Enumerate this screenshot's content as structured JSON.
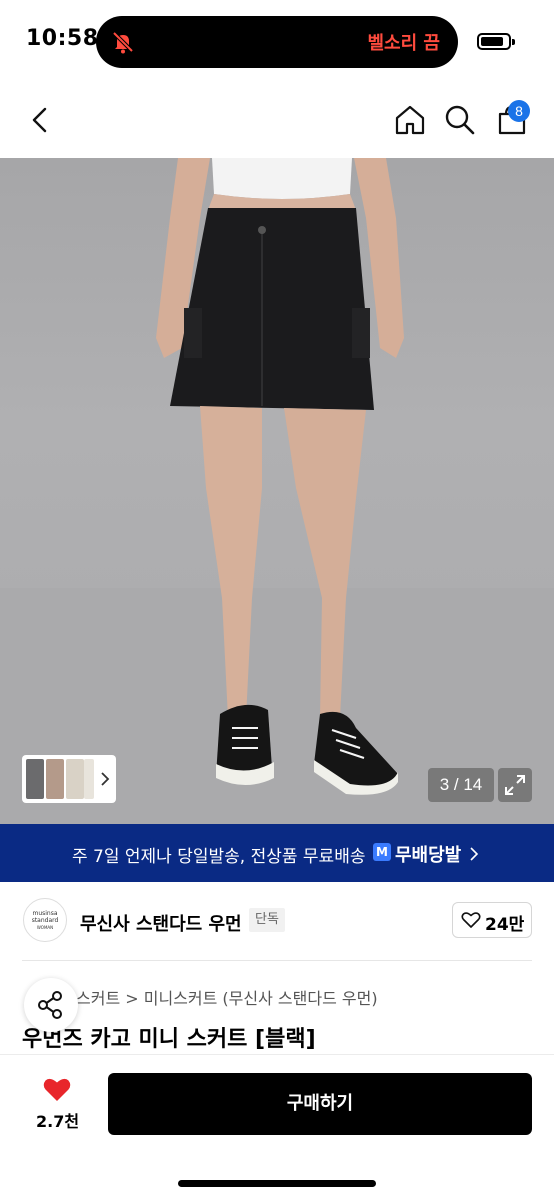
{
  "status_bar": {
    "time": "10:58",
    "island_text": "벨소리 끔",
    "icons": [
      "bell-slash-icon",
      "battery-icon"
    ]
  },
  "nav": {
    "icons": [
      "back-icon",
      "home-icon",
      "search-icon",
      "cart-icon"
    ],
    "cart_count": "8"
  },
  "gallery": {
    "counter": "3 / 14",
    "expand_icon": "expand-icon",
    "thumb_arrow_icon": "chevron-right-icon"
  },
  "shipping": {
    "text": "주 7일 언제나 당일발송, 전상품 무료배송",
    "badge": "M",
    "brand": "무배당발"
  },
  "brand": {
    "logo_lines": [
      "musinsa",
      "standard",
      "WOMAN"
    ],
    "name": "무신사 스탠다드 우먼",
    "tag": "단독",
    "likes": "24만"
  },
  "product": {
    "breadcrumb": "스커트 > 미니스커트 (무신사 스탠다드 우먼)",
    "title": "우먼즈 카고 미니 스커트 [블랙]"
  },
  "bottom": {
    "wish_count": "2.7천",
    "buy_label": "구매하기"
  },
  "colors": {
    "accent_blue": "#1a73e8",
    "banner_navy": "#0a2a84",
    "heart_red": "#e8262b",
    "island_red": "#ff4b3e"
  }
}
